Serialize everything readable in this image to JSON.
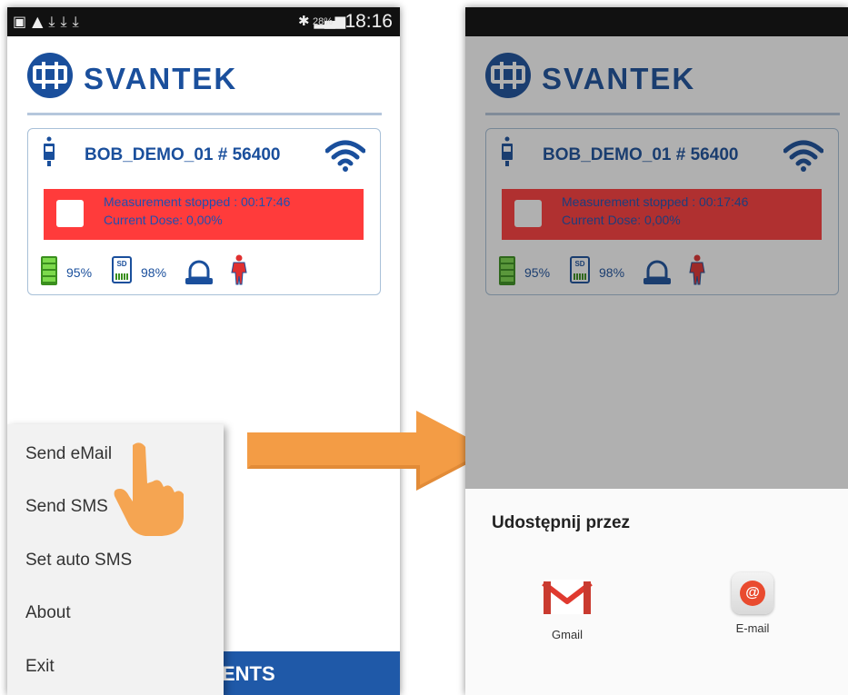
{
  "left_screen": {
    "statusbar": {
      "battery_percent": "28%",
      "time": "18:16"
    },
    "logo_text": "SVANTEK",
    "device_card": {
      "title": "BOB_DEMO_01 # 56400",
      "alert_line1": "Measurement stopped : 00:17:46",
      "alert_line2": "Current Dose: 0,00%",
      "battery_level": "95%",
      "sd_level": "98%",
      "sd_label": "SD"
    },
    "menu": {
      "items": [
        {
          "label": "Send eMail"
        },
        {
          "label": "Send SMS"
        },
        {
          "label": "Set auto SMS"
        },
        {
          "label": "About"
        },
        {
          "label": "Exit"
        }
      ]
    },
    "bottom_bar_text": "ENTS"
  },
  "right_screen": {
    "logo_text": "SVANTEK",
    "device_card": {
      "title": "BOB_DEMO_01 # 56400",
      "alert_line1": "Measurement stopped : 00:17:46",
      "alert_line2": "Current Dose: 0,00%",
      "battery_level": "95%",
      "sd_level": "98%",
      "sd_label": "SD"
    },
    "share_sheet": {
      "title": "Udostępnij przez",
      "apps": [
        {
          "label": "Gmail",
          "icon": "gmail-icon"
        },
        {
          "label": "E-mail",
          "icon": "email-icon",
          "glyph": "@"
        }
      ]
    }
  },
  "colors": {
    "brand_blue": "#1a4f9c",
    "alert_red": "#ff3b3b",
    "arrow_orange": "#f39c45"
  }
}
